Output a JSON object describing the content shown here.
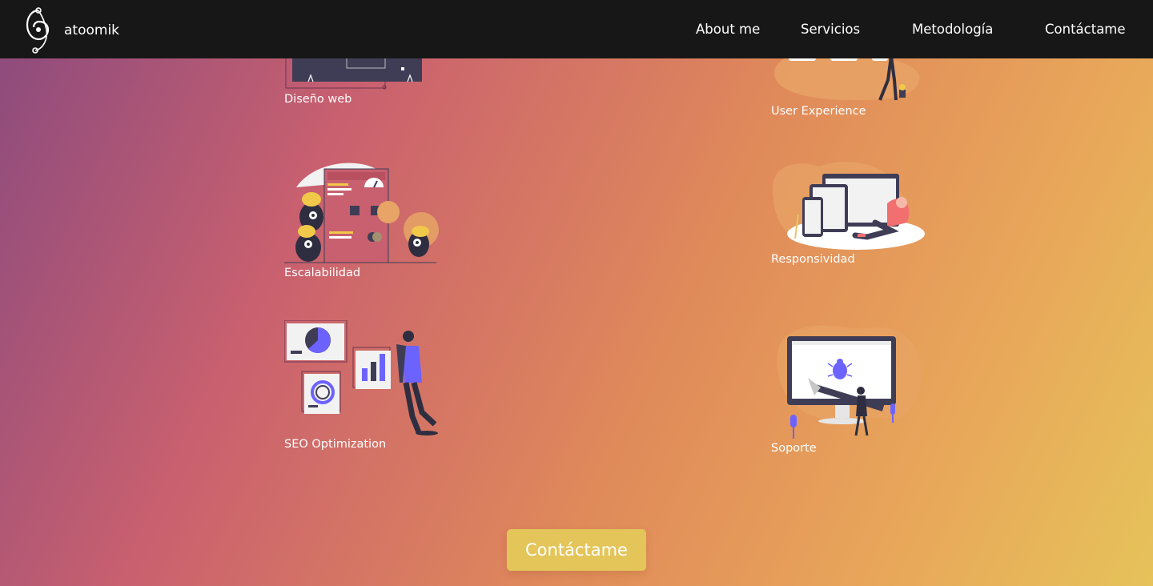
{
  "header": {
    "brand_name": "atoomik",
    "nav": [
      {
        "label": "About me"
      },
      {
        "label": "Servicios"
      },
      {
        "label": "Metodología"
      },
      {
        "label": "Contáctame"
      }
    ]
  },
  "services": [
    {
      "label": "Diseño web",
      "icon": "web-design-illustration"
    },
    {
      "label": "User Experience",
      "icon": "user-experience-illustration"
    },
    {
      "label": "Escalabilidad",
      "icon": "scalability-illustration"
    },
    {
      "label": "Responsividad",
      "icon": "responsive-devices-illustration"
    },
    {
      "label": "SEO Optimization",
      "icon": "seo-analytics-illustration"
    },
    {
      "label": "Soporte",
      "icon": "support-bug-fix-illustration"
    }
  ],
  "cta": {
    "label": "Contáctame"
  },
  "colors": {
    "topbar": "#171717",
    "cta": "#e3c55a",
    "accent_purple": "#6c63ff",
    "accent_yellow": "#f0c94a"
  }
}
